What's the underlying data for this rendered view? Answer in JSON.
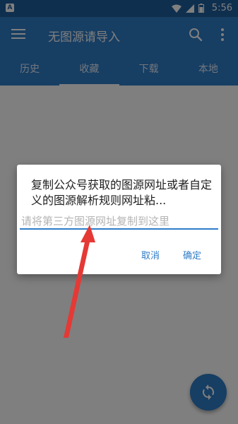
{
  "status_bar": {
    "time": "5:56",
    "app_badge": "A"
  },
  "app_bar": {
    "title": "无图源请导入"
  },
  "tabs": [
    {
      "label": "历史"
    },
    {
      "label": "收藏"
    },
    {
      "label": "下载"
    },
    {
      "label": "本地"
    }
  ],
  "active_tab": 1,
  "dialog": {
    "message": "复制公众号获取的图源网址或者自定义的图源解析规则网址粘...",
    "input_placeholder": "请将第三方图源网址复制到这里",
    "cancel_label": "取消",
    "ok_label": "确定"
  },
  "colors": {
    "primary": "#2f7cc7",
    "status_bar": "#1e5f9e",
    "annotation_arrow": "#e53935"
  }
}
